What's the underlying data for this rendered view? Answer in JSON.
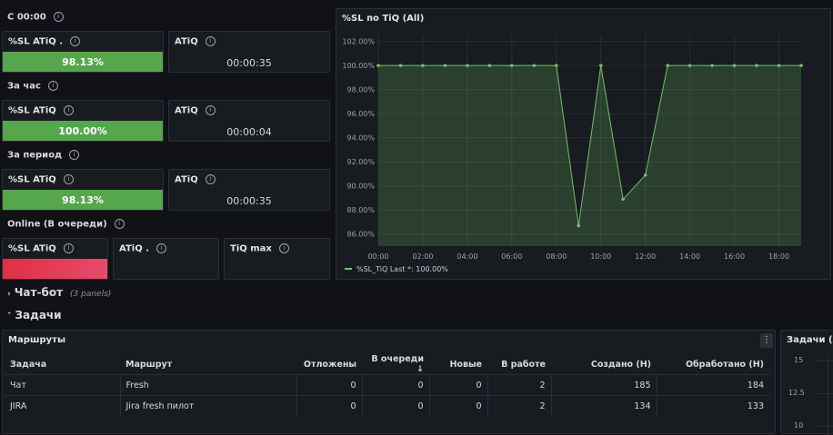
{
  "rows": {
    "r1": "С 00:00",
    "r2": "За час",
    "r3": "За период",
    "r4": "Online (В очереди)"
  },
  "stats": {
    "r1_sl_title": "%SL ATiQ .",
    "r1_sl_value": "98.13%",
    "r1_atiq_title": "ATiQ",
    "r1_atiq_value": "00:00:35",
    "r2_sl_title": "%SL ATiQ",
    "r2_sl_value": "100.00%",
    "r2_atiq_title": "ATiQ",
    "r2_atiq_value": "00:00:04",
    "r3_sl_title": "%SL ATiQ",
    "r3_sl_value": "98.13%",
    "r3_atiq_title": "ATiQ",
    "r3_atiq_value": "00:00:35",
    "r4_sl_title": "%SL ATiQ",
    "r4_atiq_title": "ATiQ .",
    "r4_tiqmax_title": "TiQ max"
  },
  "colors": {
    "good": "#56a64b",
    "bad": "#e02f44",
    "series": "#73bf69"
  },
  "chat_bot": {
    "title": "Чат-бот",
    "note": "(3 panels)"
  },
  "tasks": {
    "title": "Задачи"
  },
  "routes": {
    "title": "Маршруты",
    "menu_icon": "vertical-dots-icon",
    "columns": [
      "Задача",
      "Маршрут",
      "Отложены",
      "В очереди ↓",
      "Новые",
      "В работе",
      "Создано (Н)",
      "Обработано (Н)"
    ],
    "rows": [
      [
        "Чат",
        "Fresh",
        "0",
        "0",
        "0",
        "2",
        "185",
        "184"
      ],
      [
        "JIRA",
        "Jira fresh пилот",
        "0",
        "0",
        "0",
        "2",
        "134",
        "133"
      ]
    ]
  },
  "tasks_all": {
    "title": "Задачи (All",
    "yticks": [
      "15",
      "12.5",
      "10"
    ]
  },
  "chart_data": {
    "type": "area",
    "title": "%SL по TiQ (All)",
    "x": [
      "00:00",
      "01:00",
      "02:00",
      "03:00",
      "04:00",
      "05:00",
      "06:00",
      "07:00",
      "08:00",
      "09:00",
      "10:00",
      "11:00",
      "12:00",
      "13:00",
      "14:00",
      "15:00",
      "16:00",
      "17:00",
      "18:00",
      "19:00"
    ],
    "x_ticks": [
      "00:00",
      "02:00",
      "04:00",
      "06:00",
      "08:00",
      "10:00",
      "12:00",
      "14:00",
      "16:00",
      "18:00"
    ],
    "series": [
      {
        "name": "%SL_TiQ",
        "values": [
          100,
          100,
          100,
          100,
          100,
          100,
          100,
          100,
          100,
          86.7,
          100,
          88.9,
          90.9,
          100,
          100,
          100,
          100,
          100,
          100,
          100
        ]
      }
    ],
    "ylim": [
      85,
      102.5
    ],
    "y_ticks": [
      "102.00%",
      "100.00%",
      "98.00%",
      "96.00%",
      "94.00%",
      "92.00%",
      "90.00%",
      "88.00%",
      "86.00%"
    ],
    "legend": "%SL_TiQ  Last *: 100.00%",
    "legend_placement": "bottom-left",
    "grid": true
  }
}
